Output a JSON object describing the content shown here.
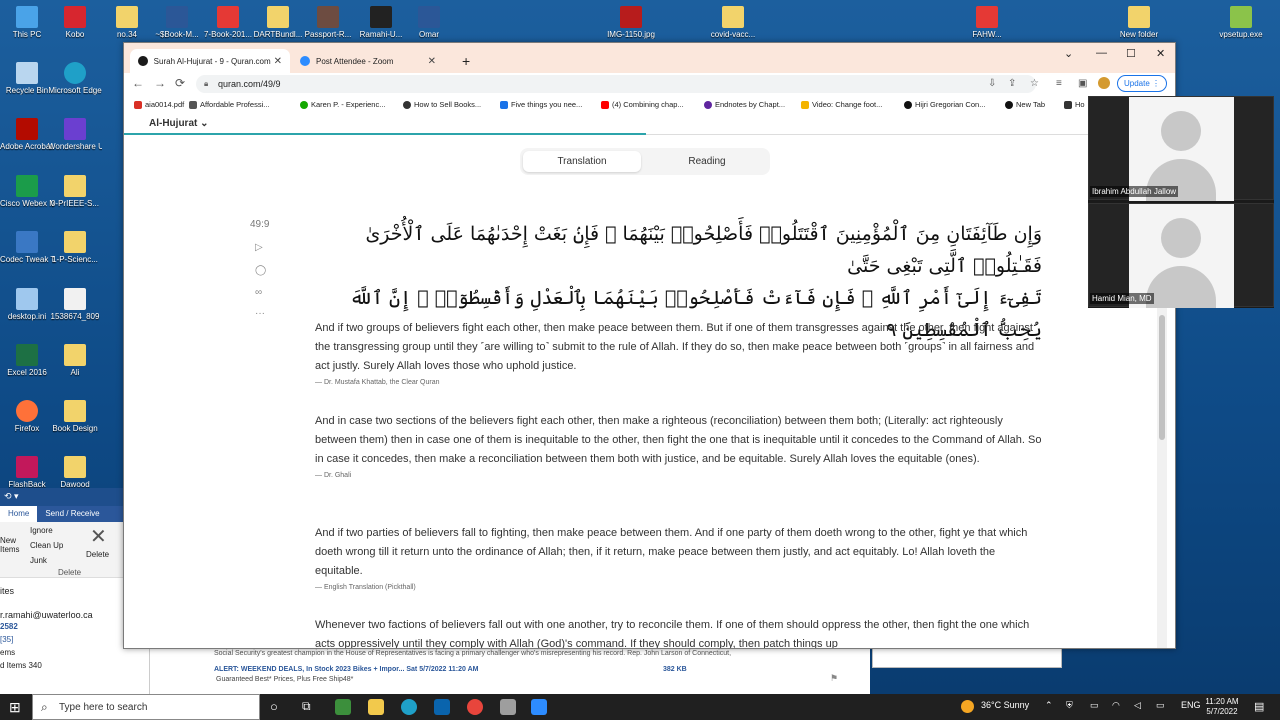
{
  "desktop": {
    "icons_left": [
      {
        "label": "This PC"
      },
      {
        "label": "Recycle Bin"
      },
      {
        "label": "Adobe Acrobat 2017"
      },
      {
        "label": "Cisco Webex Meetings"
      },
      {
        "label": "Codec Tweak Tool"
      },
      {
        "label": "desktop.ini"
      },
      {
        "label": "Excel 2016"
      },
      {
        "label": "Firefox"
      },
      {
        "label": "FlashBack"
      }
    ],
    "icons_col2": [
      {
        "label": "Kobo"
      },
      {
        "label": "Microsoft Edge"
      },
      {
        "label": "Wondershare UniConverter"
      },
      {
        "label": "0-PrIEEE-S..."
      },
      {
        "label": "1-P-Scienc..."
      },
      {
        "label": "1538674_809"
      },
      {
        "label": "Ali"
      },
      {
        "label": "Book Design"
      },
      {
        "label": "Dawood"
      }
    ],
    "icons_top": [
      {
        "label": "no.34"
      },
      {
        "label": "~$Book-M..."
      },
      {
        "label": "7-Book-201..."
      },
      {
        "label": "DARTBundl..."
      },
      {
        "label": "Passport-R..."
      },
      {
        "label": "Ramahi-U..."
      },
      {
        "label": "Omar"
      },
      {
        "label": "IMG-1150.jpg"
      },
      {
        "label": "covid-vacc..."
      },
      {
        "label": "FAHW..."
      },
      {
        "label": "New folder"
      },
      {
        "label": "vpsetup.exe"
      }
    ]
  },
  "outlook": {
    "tabs": [
      "Home",
      "Send / Receive"
    ],
    "ribbon": {
      "ignore": "Ignore",
      "cleanup": "Clean Up",
      "junk": "Junk",
      "delete": "Delete",
      "new_items": "New Items",
      "group": "Delete"
    },
    "list": [
      "ites",
      "r.ramahi@uwaterloo.ca",
      "2582",
      "[35]",
      "ems",
      "d Items 340"
    ],
    "mail_line1": "Social Security's greatest champion in the House of Representatives is facing a primary challenger who's misrepresenting his record. Rep. John Larson of Connecticut,",
    "mail_subject": "ALERT: WEEKEND DEALS, In Stock 2023 Bikes + Impor... Sat 5/7/2022 11:20 AM",
    "mail_size": "382 KB",
    "mail_line3": "Guaranteed Best* Prices, Plus Free Ship48*"
  },
  "browser": {
    "tabs": [
      {
        "title": "Surah Al-Hujurat - 9 - Quran.com",
        "active": true,
        "color": "#1a1a1a"
      },
      {
        "title": "Post Attendee - Zoom",
        "active": false,
        "color": "#2d8cff"
      }
    ],
    "new_tab": "+",
    "url": "quran.com/49/9",
    "update_label": "Update",
    "bookmarks": [
      {
        "label": "aia0014.pdf",
        "color": "#d93025"
      },
      {
        "label": "Affordable Professi...",
        "color": "#555555"
      },
      {
        "label": "Karen P. - Experienc...",
        "color": "#14a800"
      },
      {
        "label": "How to Sell Books...",
        "color": "#333333"
      },
      {
        "label": "Five things you nee...",
        "color": "#1a73e8"
      },
      {
        "label": "(4) Combining chap...",
        "color": "#ff0000"
      },
      {
        "label": "Endnotes by Chapt...",
        "color": "#5f259f"
      },
      {
        "label": "Video: Change foot...",
        "color": "#f4b400"
      },
      {
        "label": "Hijri Gregorian Con...",
        "color": "#111111"
      },
      {
        "label": "New Tab",
        "color": "#111111"
      },
      {
        "label": "Ho",
        "color": "#333333"
      }
    ]
  },
  "quran": {
    "surah_name": "Al-Hujurat",
    "reading_progress": 0.5,
    "toggle": {
      "translation": "Translation",
      "reading": "Reading"
    },
    "verse_key": "49:9",
    "arabic_line1": "وَإِن طَآئِفَتَانِ مِنَ ٱلْمُؤْمِنِينَ ٱقْتَتَلُوا۟ فَأَصْلِحُوا۟ بَيْنَهُمَا ۖ فَإِنۢ بَغَتْ إِحْدَىٰهُمَا عَلَى ٱلْأُخْرَىٰ فَقَـٰتِلُوا۟ ٱلَّتِى تَبْغِى حَتَّىٰ",
    "arabic_line2": "تَفِىٓءَ إِلَىٰٓ أَمْرِ ٱللَّهِ ۚ فَإِن فَآءَتْ فَأَصْلِحُوا۟ بَيْنَهُمَا بِٱلْعَدْلِ وَأَقْسِطُوٓا۟ ۖ إِنَّ ٱللَّهَ يُحِبُّ ٱلْمُقْسِطِينَ ٩",
    "translations": [
      {
        "text": "And if two groups of believers fight each other, then make peace between them. But if one of them transgresses against the other, then fight against the transgressing group until they ˹are willing to˺ submit to the rule of Allah. If they do so, then make peace between both ˹groups˺ in all fairness and act justly. Surely Allah loves those who uphold justice.",
        "source": "— Dr. Mustafa Khattab, the Clear Quran"
      },
      {
        "text": "And in case two sections of the believers fight each other, then make a righteous (reconciliation) between them both; (Literally: act righteously between them) then in case one of them is inequitable to the other, then fight the one that is inequitable until it concedes to the Command of Allah. So in case it concedes, then make a reconciliation between them both with justice, and be equitable. Surely Allah loves the equitable (ones).",
        "source": "— Dr. Ghali"
      },
      {
        "text": "And if two parties of believers fall to fighting, then make peace between them. And if one party of them doeth wrong to the other, fight ye that which doeth wrong till it return unto the ordinance of Allah; then, if it return, make peace between them justly, and act equitably. Lo! Allah loveth the equitable.",
        "source": "— English Translation (Pickthall)"
      },
      {
        "text": "Whenever two factions of believers fall out with one another, try to reconcile them. If one of them should oppress the other, then fight the one which acts oppressively until they comply with Allah (God)'s command. If they should comply, then patch things up",
        "source": ""
      }
    ]
  },
  "zoom": {
    "participants": [
      {
        "name": "Ibrahim Abdullah Jallow"
      },
      {
        "name": "Hamid Mian, MD"
      }
    ]
  },
  "taskbar": {
    "search_placeholder": "Type here to search",
    "weather": "36°C  Sunny",
    "language": "ENG",
    "time": "11:20 AM",
    "date": "5/7/2022"
  }
}
